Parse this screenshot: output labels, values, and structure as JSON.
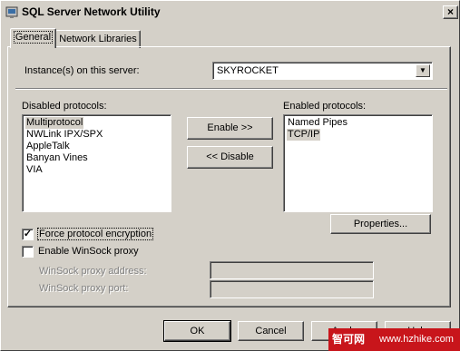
{
  "window": {
    "title": "SQL Server Network Utility",
    "close_glyph": "×"
  },
  "tabs": [
    {
      "label": "General",
      "active": true
    },
    {
      "label": "Network Libraries",
      "active": false
    }
  ],
  "instance": {
    "label": "Instance(s) on this server:",
    "value": "SKYROCKET"
  },
  "disabled_protocols": {
    "label": "Disabled protocols:",
    "items": [
      "Multiprotocol",
      "NWLink IPX/SPX",
      "AppleTalk",
      "Banyan Vines",
      "VIA"
    ],
    "selected": "Multiprotocol"
  },
  "enabled_protocols": {
    "label": "Enabled protocols:",
    "items": [
      "Named Pipes",
      "TCP/IP"
    ],
    "selected": "TCP/IP"
  },
  "buttons": {
    "enable": "Enable >>",
    "disable": "<< Disable",
    "properties": "Properties...",
    "ok": "OK",
    "cancel": "Cancel",
    "apply": "Apply",
    "help": "Help"
  },
  "options": {
    "force_encryption": {
      "label": "Force protocol encryption",
      "checked": true
    },
    "enable_winsock_proxy": {
      "label": "Enable WinSock proxy",
      "checked": false
    },
    "proxy_address_label": "WinSock proxy address:",
    "proxy_port_label": "WinSock proxy port:"
  },
  "watermark": {
    "logo": "智可网",
    "url": "www.hzhike.com"
  }
}
